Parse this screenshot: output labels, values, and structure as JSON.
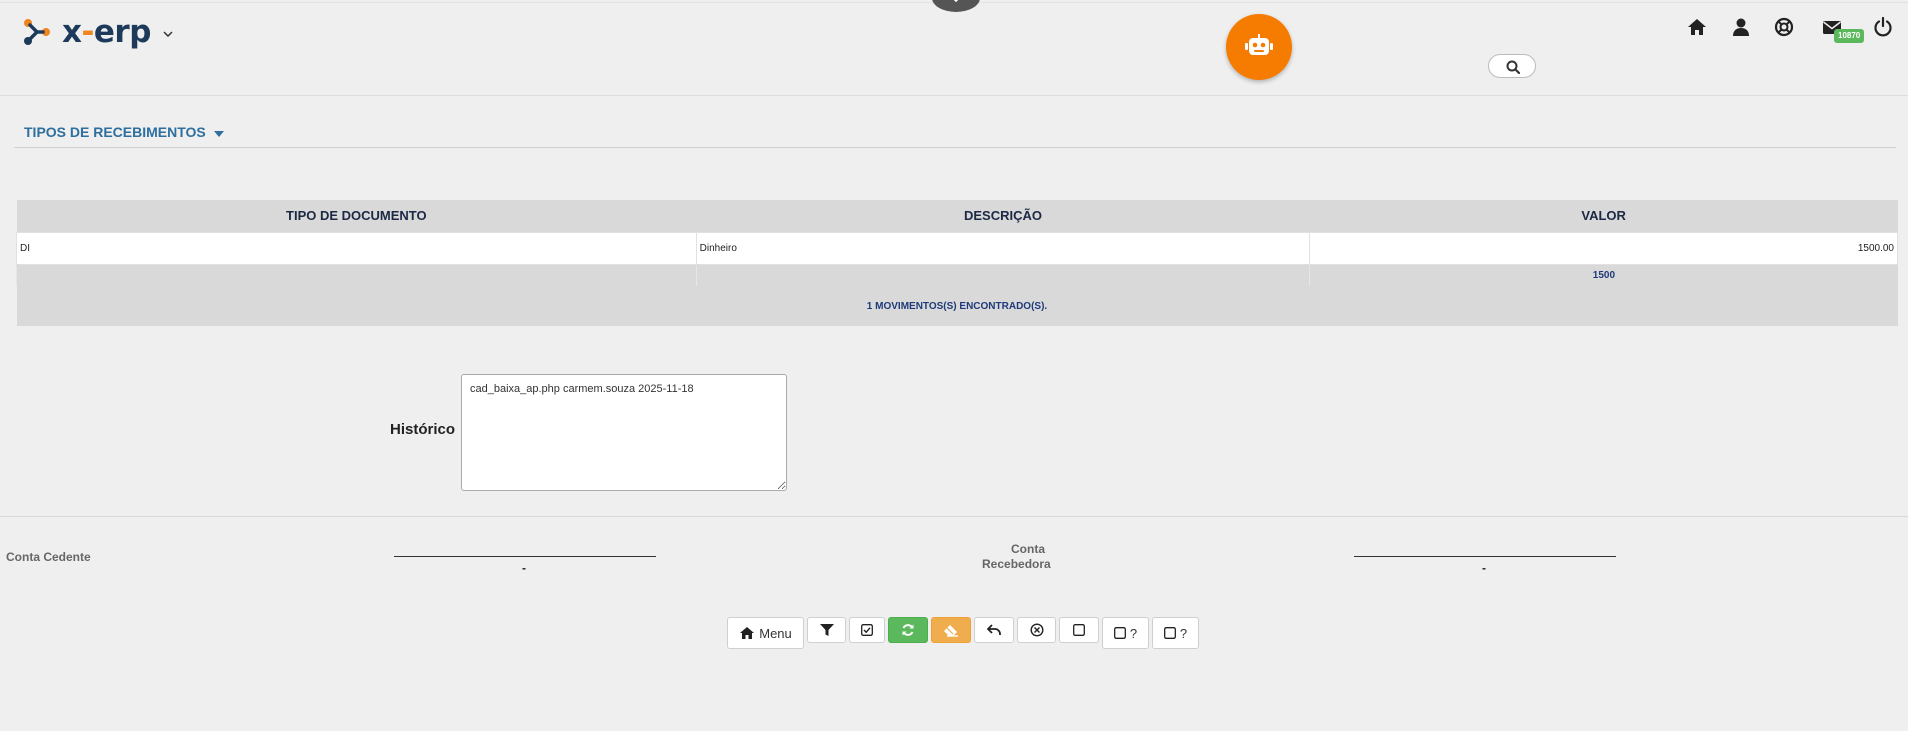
{
  "header": {
    "logo_text_prefix": "x",
    "logo_text_dash": "-",
    "logo_text_suffix": "erp",
    "mail_badge": "10870",
    "icons": [
      "home-icon",
      "user-icon",
      "support-icon",
      "mail-icon",
      "power-icon",
      "robot-icon",
      "search-icon"
    ],
    "colors": {
      "brand_navy": "#1d3a5b",
      "brand_orange": "#f0841f",
      "bot_orange": "#f57c00",
      "badge_green": "#5cb85c"
    }
  },
  "section": {
    "title": "TIPOS DE RECEBIMENTOS"
  },
  "table": {
    "columns": [
      "TIPO DE DOCUMENTO",
      "DESCRIÇÃO",
      "VALOR"
    ],
    "rows": [
      {
        "tipo": "DI",
        "descricao": "Dinheiro",
        "valor": "1500.00"
      }
    ],
    "total": "1500",
    "found_text": "1 MOVIMENTOS(S) ENCONTRADO(S)."
  },
  "historico": {
    "label": "Histórico",
    "value": "cad_baixa_ap.php carmem.souza 2025-11-18"
  },
  "signatures": {
    "cedente_label": "Conta Cedente",
    "recebedora_label_line1": "Conta",
    "recebedora_label_line2": "Recebedora",
    "dash": "-"
  },
  "toolbar": {
    "menu_label": "Menu",
    "help_label_1": "?",
    "help_label_2": "?"
  }
}
